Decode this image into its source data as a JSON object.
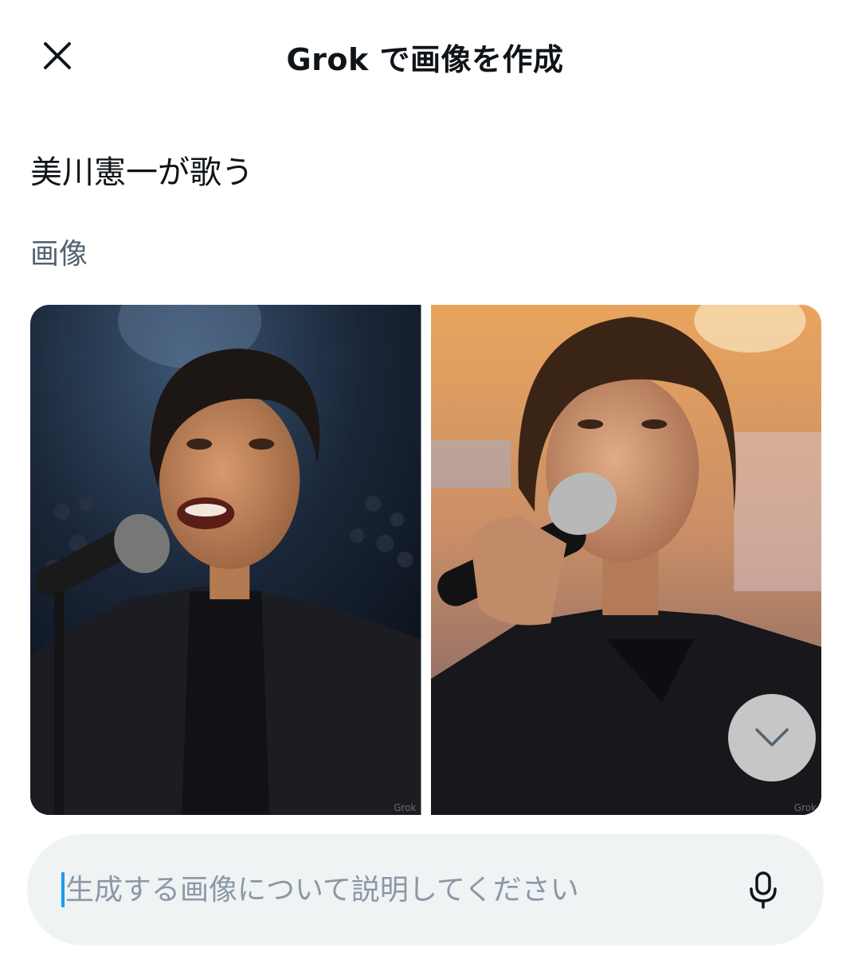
{
  "header": {
    "title": "Grok で画像を作成",
    "close_icon": "close-icon"
  },
  "prompt": {
    "text": "美川憲一が歌う"
  },
  "section": {
    "label": "画像"
  },
  "images": [
    {
      "watermark": "Grok"
    },
    {
      "watermark": "Grok"
    }
  ],
  "scroll_down": {
    "icon": "chevron-down-icon"
  },
  "composer": {
    "placeholder": "生成する画像について説明してください",
    "value": "",
    "mic_icon": "microphone-icon"
  },
  "colors": {
    "accent": "#1d9bf0",
    "text": "#0f1419",
    "muted": "#536471",
    "composer_bg": "#eff3f4"
  }
}
